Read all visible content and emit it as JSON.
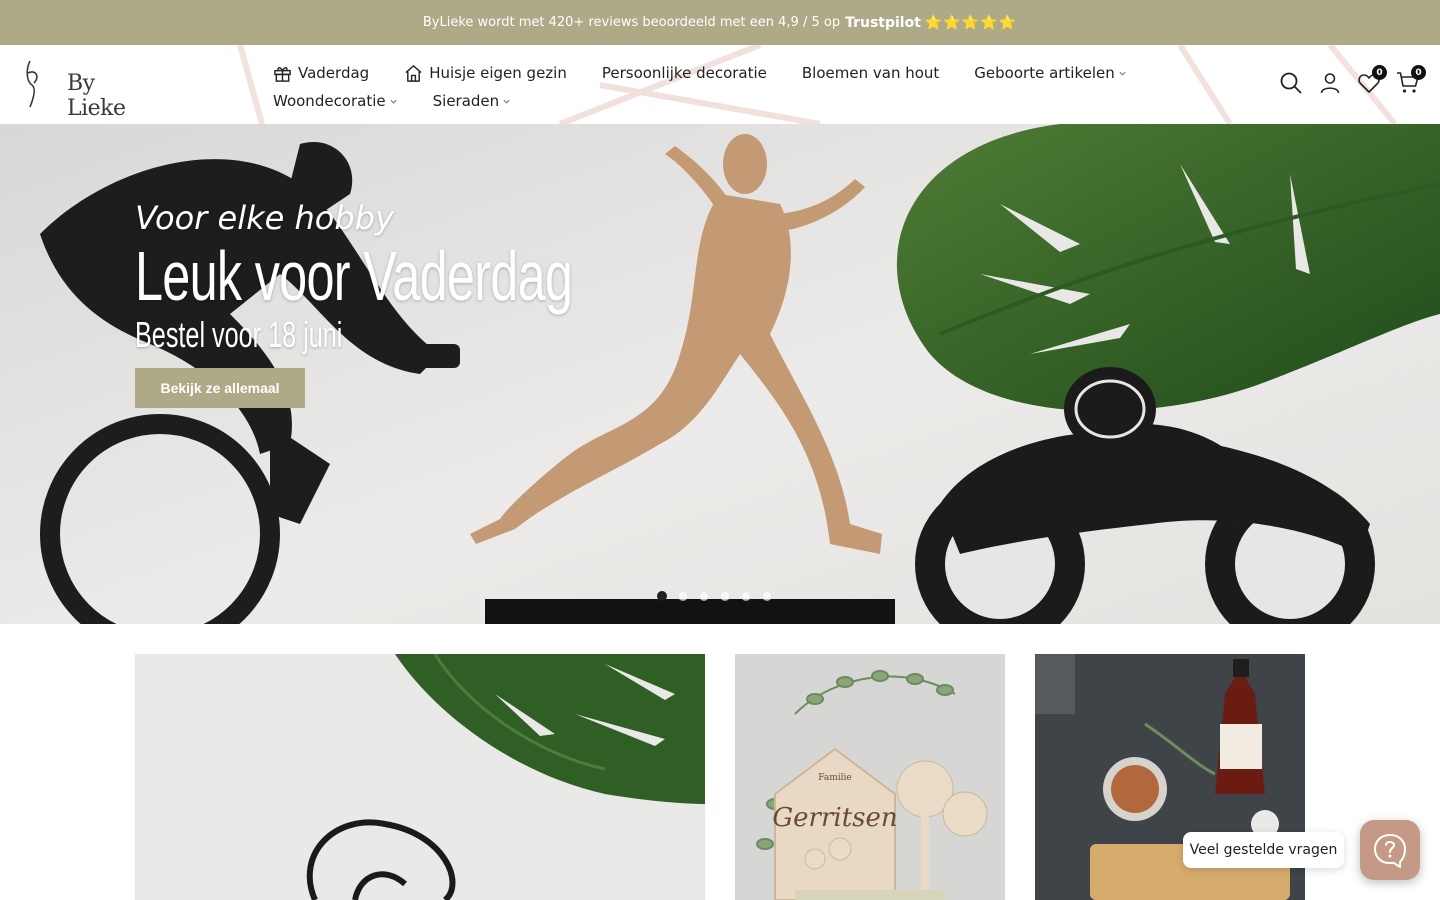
{
  "announcement": {
    "text": "ByLieke wordt met 420+ reviews beoordeeld met een 4,9 / 5 op",
    "brand": "Trustpilot",
    "stars": "⭐⭐⭐⭐⭐",
    "bg_color": "#aea987"
  },
  "header": {
    "logo_text": "By Lieke",
    "nav": [
      {
        "label": "Vaderdag",
        "icon": "gift-icon"
      },
      {
        "label": "Huisje eigen gezin",
        "icon": "home-icon"
      },
      {
        "label": "Persoonlijke decoratie"
      },
      {
        "label": "Bloemen van hout"
      },
      {
        "label": "Geboorte artikelen",
        "dropdown": true
      },
      {
        "label": "Woondecoratie",
        "dropdown": true
      },
      {
        "label": "Sieraden",
        "dropdown": true
      }
    ],
    "icons": [
      "search-icon",
      "account-icon",
      "wishlist-icon",
      "cart-icon"
    ],
    "wishlist_count": "0",
    "cart_count": "0"
  },
  "hero": {
    "subtitle": "Voor elke hobby",
    "title": "Leuk voor Vaderdag",
    "note": "Bestel voor 18 juni",
    "button_label": "Bekijk ze allemaal",
    "slide_count": 6,
    "active_slide": 1
  },
  "help": {
    "faq_label": "Veel gestelde vragen",
    "button_icon": "question-icon",
    "button_color": "#c49a86"
  }
}
